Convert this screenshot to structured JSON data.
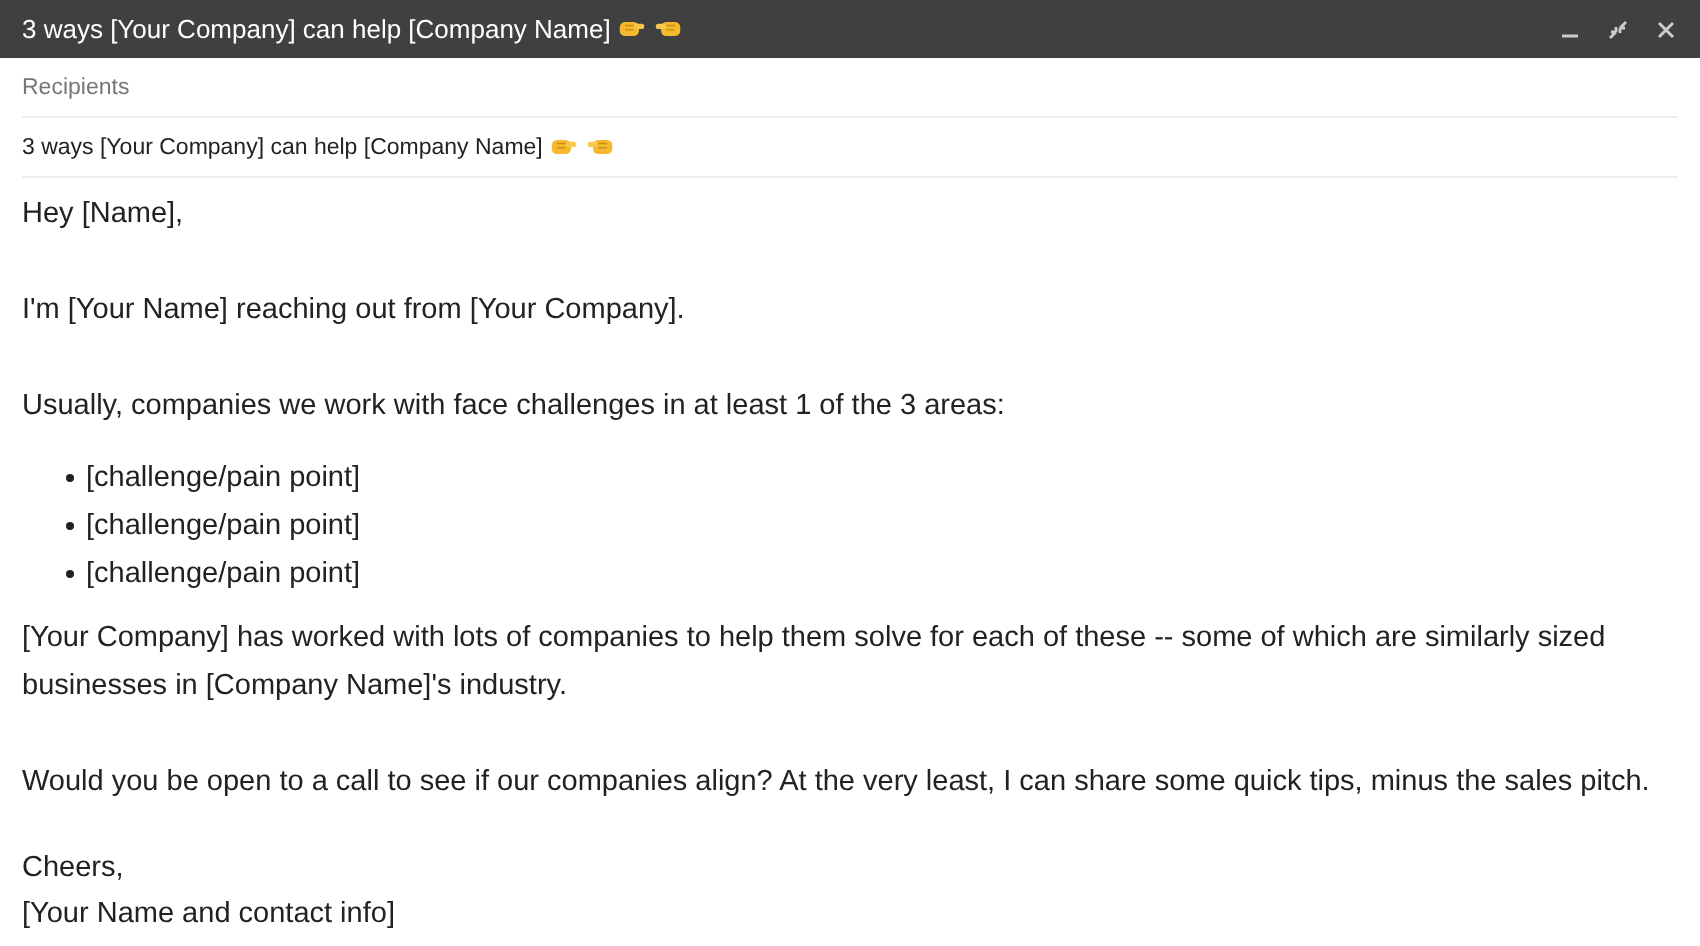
{
  "window": {
    "title": "3 ways [Your Company] can help [Company Name]"
  },
  "recipients": {
    "placeholder": "Recipients"
  },
  "subject": {
    "value": "3 ways [Your Company] can help [Company Name]"
  },
  "body": [
    {
      "kind": "para",
      "text": "Hey [Name],"
    },
    {
      "kind": "para",
      "text": "I'm [Your Name] reaching out from [Your Company]."
    },
    {
      "kind": "para",
      "text": "Usually, companies we work with face challenges in at least 1 of the 3 areas:"
    },
    {
      "kind": "list",
      "items": [
        "[challenge/pain point]",
        "[challenge/pain point]",
        "[challenge/pain point]"
      ]
    },
    {
      "kind": "para",
      "text": "[Your Company] has worked with lots of companies to help them solve for each of these -- some of which are similarly sized businesses in [Company Name]'s industry."
    },
    {
      "kind": "para",
      "text": "Would you be open to a call to see if our companies align? At the very least, I can share some quick tips, minus the sales pitch."
    },
    {
      "kind": "lines",
      "items": [
        "Cheers,",
        "[Your Name and contact info]"
      ]
    }
  ]
}
